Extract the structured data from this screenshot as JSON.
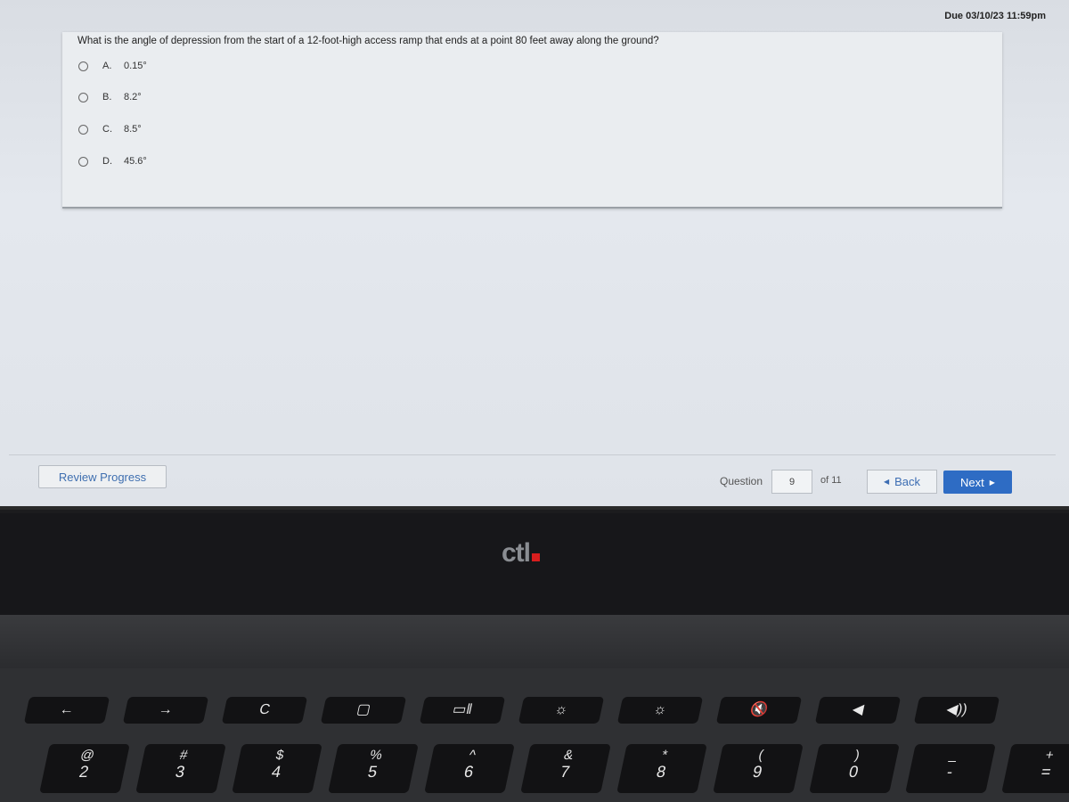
{
  "due": "Due 03/10/23 11:59pm",
  "question": {
    "text": "What is the angle of depression from the start of a 12-foot-high access ramp that ends at a point 80 feet away along the ground?",
    "options": [
      {
        "letter": "A.",
        "value": "0.15°"
      },
      {
        "letter": "B.",
        "value": "8.2°"
      },
      {
        "letter": "C.",
        "value": "8.5°"
      },
      {
        "letter": "D.",
        "value": "45.6°"
      }
    ]
  },
  "footer": {
    "review": "Review Progress",
    "question_label": "Question",
    "question_number": "9",
    "of": "of 11",
    "back": "Back",
    "next": "Next"
  },
  "laptop": {
    "logo": "ctl",
    "function_keys": [
      "←",
      "→",
      "C",
      "▢",
      "▭‖",
      "☼",
      "☼",
      "🔇",
      "◀",
      "◀))"
    ],
    "number_keys": [
      {
        "top": "@",
        "bot": "2"
      },
      {
        "top": "#",
        "bot": "3"
      },
      {
        "top": "$",
        "bot": "4"
      },
      {
        "top": "%",
        "bot": "5"
      },
      {
        "top": "^",
        "bot": "6"
      },
      {
        "top": "&",
        "bot": "7"
      },
      {
        "top": "*",
        "bot": "8"
      },
      {
        "top": "(",
        "bot": "9"
      },
      {
        "top": ")",
        "bot": "0"
      },
      {
        "top": "_",
        "bot": "-"
      },
      {
        "top": "+",
        "bot": "="
      }
    ]
  }
}
